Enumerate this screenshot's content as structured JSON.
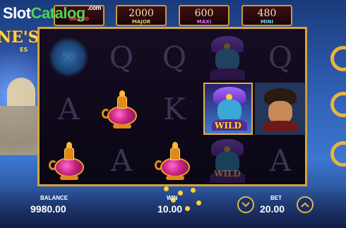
{
  "brand": {
    "main": "Slot",
    "accent": "Catalog",
    "suffix": ".com"
  },
  "game_title": {
    "line1": "NE'S",
    "line2": "ES"
  },
  "jackpots": {
    "grand": {
      "value": "",
      "name": "GRAND"
    },
    "major": {
      "value": "2000",
      "name": "MAJOR"
    },
    "maxi": {
      "value": "600",
      "name": "MAXI"
    },
    "mini": {
      "value": "480",
      "name": "MINI"
    }
  },
  "reels": {
    "scatter_value": "50",
    "wild_label": "WILD",
    "grid": [
      [
        "scatter",
        "Q",
        "Q",
        "genie-dim",
        "Q"
      ],
      [
        "A",
        "lamp",
        "K",
        "genie-wild",
        "aladdin"
      ],
      [
        "lamp",
        "A",
        "lamp",
        "genie-wild-dim",
        "A"
      ]
    ]
  },
  "balance": {
    "label": "BALANCE",
    "value": "9980.00"
  },
  "win": {
    "label": "WIN",
    "value": "10.00"
  },
  "bet": {
    "label": "BET",
    "value": "20.00"
  },
  "colors": {
    "frame": "#d7a33a",
    "accent": "#ffd34a"
  }
}
